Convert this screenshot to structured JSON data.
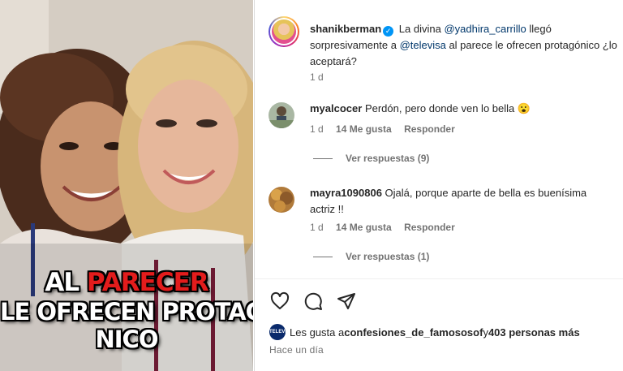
{
  "photo": {
    "caption_line1_a": "AL ",
    "caption_line1_b": "PARECER",
    "caption_line2": "LE OFRECEN PROTAGÓ",
    "caption_line3": "NICO"
  },
  "post": {
    "username": "shanikberman",
    "verified_icon": "check",
    "text_a": "La divina ",
    "mention_1": "@yadhira_carrillo",
    "text_b": " llegó sorpresivamente a ",
    "mention_2": "@televisa",
    "text_c": " al parece le ofrecen protagónico ¿lo aceptará?",
    "time": "1 d"
  },
  "comments": [
    {
      "username": "myalcocer",
      "text": "Perdón, pero donde ven lo bella 😮",
      "time": "1 d",
      "likes": "14 Me gusta",
      "reply": "Responder",
      "view_replies": "Ver respuestas (9)"
    },
    {
      "username": "mayra1090806",
      "text": "Ojalá, porque aparte de bella es buenísima actriz !!",
      "time": "1 d",
      "likes": "14 Me gusta",
      "reply": "Responder",
      "view_replies": "Ver respuestas (1)"
    }
  ],
  "actions": {
    "icons": [
      "heart-icon",
      "comment-icon",
      "share-icon"
    ]
  },
  "likes": {
    "prefix": "Les gusta a ",
    "user": "confesiones_de_famososof",
    "middle": " y ",
    "count": "403 personas más"
  },
  "post_time": "Hace un día",
  "colors": {
    "link": "#00376b",
    "verified": "#0095f6",
    "caption_red": "#e31c1c"
  }
}
